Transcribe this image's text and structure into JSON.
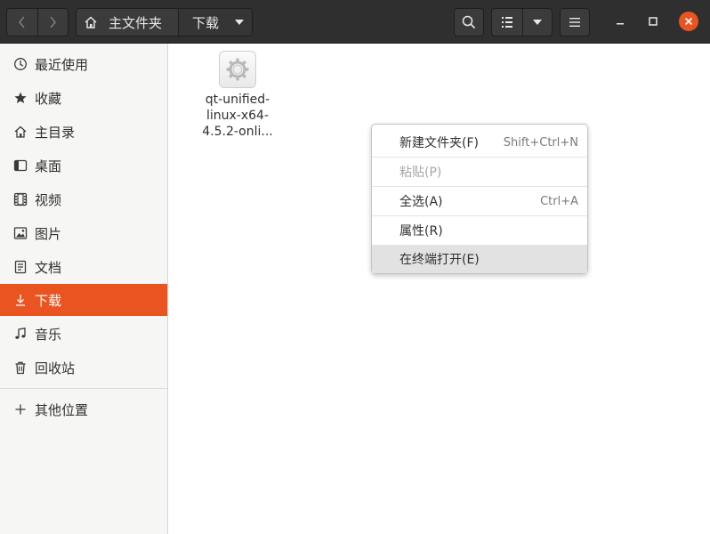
{
  "header": {
    "breadcrumb_home": "主文件夹",
    "breadcrumb_current": "下载"
  },
  "sidebar": {
    "items": [
      {
        "label": "最近使用",
        "icon": "clock-icon"
      },
      {
        "label": "收藏",
        "icon": "star-icon"
      },
      {
        "label": "主目录",
        "icon": "home-icon"
      },
      {
        "label": "桌面",
        "icon": "desktop-icon"
      },
      {
        "label": "视频",
        "icon": "video-icon"
      },
      {
        "label": "图片",
        "icon": "image-icon"
      },
      {
        "label": "文档",
        "icon": "document-icon"
      },
      {
        "label": "下载",
        "icon": "download-icon"
      },
      {
        "label": "音乐",
        "icon": "music-icon"
      },
      {
        "label": "回收站",
        "icon": "trash-icon"
      }
    ],
    "other_locations": "其他位置"
  },
  "files": [
    {
      "name_lines": [
        "qt-unified-",
        "linux-x64-",
        "4.5.2-onli..."
      ],
      "icon": "executable-gear-icon"
    }
  ],
  "context_menu": {
    "items": [
      {
        "label": "新建文件夹(F)",
        "accel": "Shift+Ctrl+N"
      },
      {
        "label": "粘贴(P)",
        "accel": ""
      },
      {
        "label": "全选(A)",
        "accel": "Ctrl+A"
      },
      {
        "label": "属性(R)",
        "accel": ""
      },
      {
        "label": "在终端打开(E)",
        "accel": ""
      }
    ]
  },
  "colors": {
    "accent": "#e95420",
    "headerbar": "#2f2f2f",
    "sidebar_bg": "#f6f6f5"
  }
}
